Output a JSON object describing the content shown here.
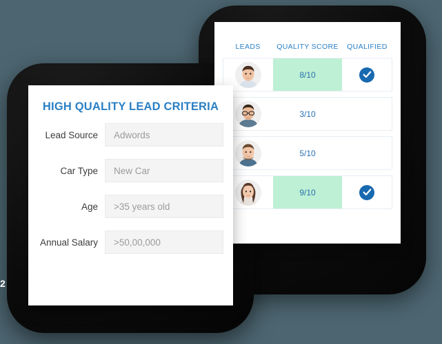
{
  "theme": {
    "background": "#4c6570",
    "frame": "#0d0d0d",
    "accent_blue": "#2a7fc4",
    "score_blue": "#2a6fb0",
    "badge_blue": "#1769b0",
    "highlight_green": "#bdf0d4",
    "input_bg": "#f4f4f4"
  },
  "edge": {
    "clipped_glyph": "2"
  },
  "leads_panel": {
    "columns": [
      {
        "label": "LEADS",
        "name": "leads"
      },
      {
        "label": "QUALITY SCORE",
        "name": "quality-score"
      },
      {
        "label": "QUALIFIED",
        "name": "qualified"
      }
    ],
    "rows": [
      {
        "avatar": "avatar-man-short-hair",
        "score": "8/10",
        "score_highlighted": true,
        "qualified": true
      },
      {
        "avatar": "avatar-man-glasses",
        "score": "3/10",
        "score_highlighted": false,
        "qualified": false
      },
      {
        "avatar": "avatar-man-beard",
        "score": "5/10",
        "score_highlighted": false,
        "qualified": false
      },
      {
        "avatar": "avatar-woman-long-hair",
        "score": "9/10",
        "score_highlighted": true,
        "qualified": true
      }
    ]
  },
  "criteria_panel": {
    "title": "HIGH QUALITY LEAD CRITERIA",
    "fields": [
      {
        "label": "Lead Source",
        "value": "Adwords",
        "name": "lead-source"
      },
      {
        "label": "Car Type",
        "value": "New Car",
        "name": "car-type"
      },
      {
        "label": "Age",
        "value": ">35 years old",
        "name": "age"
      },
      {
        "label": "Annual Salary",
        "value": ">50,00,000",
        "name": "annual-salary"
      }
    ]
  }
}
